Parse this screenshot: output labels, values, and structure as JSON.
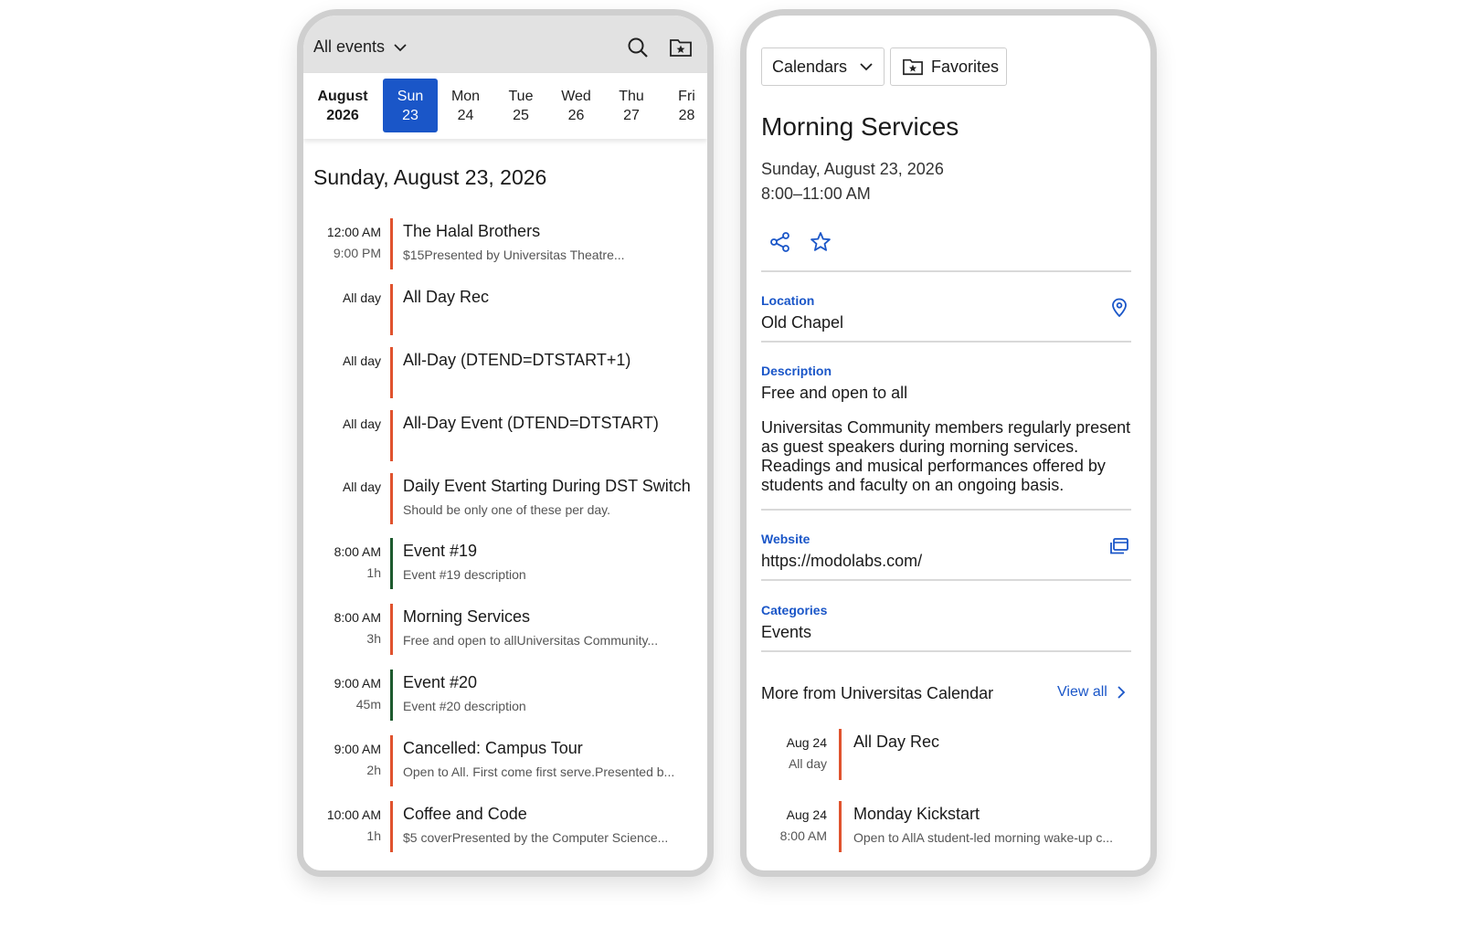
{
  "left": {
    "filter_label": "All events",
    "month": [
      "August",
      "2026"
    ],
    "days": [
      {
        "name": "Sun",
        "num": "23"
      },
      {
        "name": "Mon",
        "num": "24"
      },
      {
        "name": "Tue",
        "num": "25"
      },
      {
        "name": "Wed",
        "num": "26"
      },
      {
        "name": "Thu",
        "num": "27"
      },
      {
        "name": "Fri",
        "num": "28"
      }
    ],
    "selected_day": 0,
    "heading": "Sunday, August 23, 2026",
    "events": [
      {
        "t1": "12:00 AM",
        "t2": "9:00 PM",
        "title": "The Halal Brothers",
        "sub": "$15Presented by Universitas Theatre...",
        "color": "#e0532e"
      },
      {
        "t1": "All day",
        "t2": "",
        "title": "All Day Rec",
        "sub": "",
        "color": "#e0532e"
      },
      {
        "t1": "All day",
        "t2": "",
        "title": "All-Day (DTEND=DTSTART+1)",
        "sub": "",
        "color": "#e0532e"
      },
      {
        "t1": "All day",
        "t2": "",
        "title": "All-Day Event (DTEND=DTSTART)",
        "sub": "",
        "color": "#e0532e"
      },
      {
        "t1": "All day",
        "t2": "",
        "title": "Daily Event Starting During DST Switch",
        "sub": "Should be only one of these per day.",
        "color": "#e0532e"
      },
      {
        "t1": "8:00 AM",
        "t2": "1h",
        "title": "Event #19",
        "sub": "Event #19 description",
        "color": "#1d5a2e"
      },
      {
        "t1": "8:00 AM",
        "t2": "3h",
        "title": "Morning Services",
        "sub": "Free and open to allUniversitas Community...",
        "color": "#e0532e"
      },
      {
        "t1": "9:00 AM",
        "t2": "45m",
        "title": "Event #20",
        "sub": "Event #20 description",
        "color": "#1d5a2e"
      },
      {
        "t1": "9:00 AM",
        "t2": "2h",
        "title": "Cancelled: Campus Tour",
        "sub": "Open to All. First come first serve.Presented b...",
        "color": "#e0532e"
      },
      {
        "t1": "10:00 AM",
        "t2": "1h",
        "title": "Coffee and Code",
        "sub": "$5 coverPresented by the Computer Science...",
        "color": "#e0532e"
      }
    ]
  },
  "right": {
    "calendars_label": "Calendars",
    "favorites_label": "Favorites",
    "title": "Morning Services",
    "date": "Sunday, August 23, 2026",
    "time": "8:00–11:00 AM",
    "location_label": "Location",
    "location": "Old Chapel",
    "description_label": "Description",
    "description_lead": "Free and open to all",
    "description_body": "Universitas Community members regularly present as guest speakers during morning services. Readings and musical performances offered by students and faculty on an ongoing basis.",
    "website_label": "Website",
    "website": "https://modolabs.com/",
    "categories_label": "Categories",
    "categories": "Events",
    "more_label": "More from Universitas Calendar",
    "view_all": "View all",
    "more_events": [
      {
        "d1": "Aug 24",
        "d2": "All day",
        "title": "All Day Rec",
        "sub": "",
        "color": "#e0532e"
      },
      {
        "d1": "Aug 24",
        "d2": "8:00 AM",
        "title": "Monday Kickstart",
        "sub": "Open to AllA student-led morning wake-up c...",
        "color": "#e0532e"
      }
    ]
  },
  "colors": {
    "accent": "#1a56c8",
    "bar_orange": "#e0532e",
    "bar_green": "#1d5a2e"
  },
  "icons": [
    "chevron-down-icon",
    "search-icon",
    "favorites-folder-icon",
    "share-icon",
    "star-icon",
    "map-pin-icon",
    "external-link-icon",
    "chevron-right-icon"
  ]
}
